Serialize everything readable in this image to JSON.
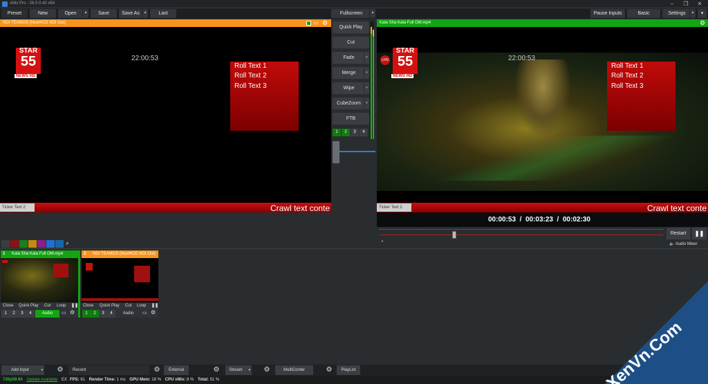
{
  "window": {
    "title": "vMix Pro - 26.0.0.40 x64"
  },
  "menu": {
    "preset": "Preset",
    "new": "New",
    "open": "Open",
    "save": "Save",
    "save_as": "Save As",
    "last": "Last",
    "fullscreen": "Fullscreen",
    "pause_inputs": "Pause Inputs",
    "basic": "Basic",
    "settings": "Settings"
  },
  "preview": {
    "header": "NDI TEAMOS (Nuxt4CG NDI Out)",
    "clock": "22:00:53",
    "roll": [
      "Roll Text 1",
      "Roll Text 2",
      "Roll Text 3"
    ],
    "ticker": "Ticker Text 2",
    "crawl": "Crawl text conte",
    "logo_top": "STAR",
    "logo_mid": "55",
    "logo_bot": "NEWS HD"
  },
  "output": {
    "header": "Kala Sha Kala Full OM.mp4",
    "clock": "22:00:53",
    "roll": [
      "Roll Text 1",
      "Roll Text 2",
      "Roll Text 3"
    ],
    "ticker": "Ticker Text 2",
    "crawl": "Crawl text conte",
    "logo_top": "STAR",
    "logo_mid": "55",
    "logo_bot": "NEWS HD",
    "tc_pos": "00:00:53",
    "tc_dur": "00:03:23",
    "tc_rem": "00:02:30",
    "progress": 0.26,
    "restart": "Restart",
    "audio_mixer": "Audio Mixer"
  },
  "transitions": {
    "quick_play": "Quick Play",
    "cut": "Cut",
    "fade": "Fade",
    "merge": "Merge",
    "wipe": "Wipe",
    "cubezoom": "CubeZoom",
    "ftb": "FTB",
    "nums": [
      "1",
      "2",
      "3",
      "4"
    ]
  },
  "colors": {
    "preview_accent": "#f7941d",
    "program_accent": "#11a611",
    "roll_red": "#b40a0a",
    "crawl_red": "#b40a0a"
  },
  "inputs": [
    {
      "num": "1",
      "name": "Kala Sha Kala Full OM.mp4",
      "btns": [
        "Close",
        "Quick Play",
        "Cut",
        "Loop"
      ],
      "nums": [
        "1",
        "2",
        "3",
        "4"
      ],
      "audio": "Audio"
    },
    {
      "num": "2",
      "name": "NDI TEAMOS (Nuxt4CG NDI Out)",
      "btns": [
        "Close",
        "Quick Play",
        "Cut",
        "Loop"
      ],
      "nums": [
        "1",
        "2",
        "3",
        "4"
      ],
      "audio": "Audio"
    }
  ],
  "bottom": {
    "add_input": "Add Input",
    "record": "Record",
    "external": "External",
    "stream": "Stream",
    "multicorder": "MultiCorder",
    "playlist": "PlayList"
  },
  "status": {
    "res": "720p59.94",
    "update": "Update Available",
    "ex_label": "EX",
    "fps_label": "FPS:",
    "fps": "61",
    "rt_label": "Render Time:",
    "rt": "1 ms",
    "gpu_label": "GPU Mem:",
    "gpu": "18 %",
    "cpu_label": "CPU vMix:",
    "cpu": "8 %",
    "total_label": "Total:",
    "total": "51 %"
  },
  "watermark": {
    "text": "XenVn.Com"
  }
}
